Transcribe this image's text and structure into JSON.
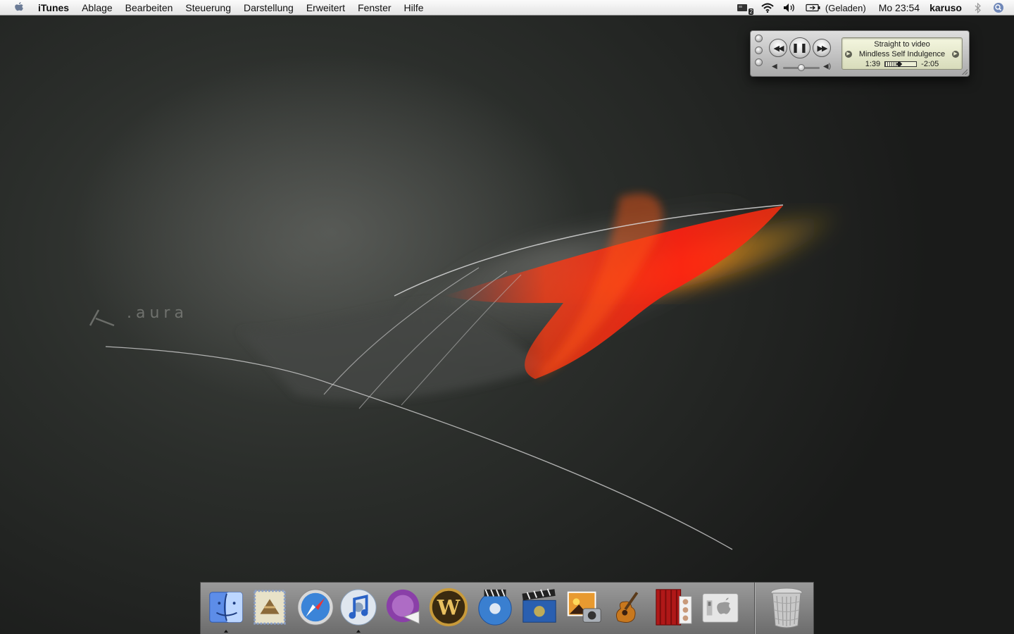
{
  "menubar": {
    "app_name": "iTunes",
    "menus": [
      "Ablage",
      "Bearbeiten",
      "Steuerung",
      "Darstellung",
      "Erweitert",
      "Fenster",
      "Hilfe"
    ],
    "extras": {
      "spaces_badge": "2",
      "battery_status": "(Geladen)",
      "clock": "Mo 23:54",
      "user": "karuso"
    }
  },
  "wallpaper": {
    "brand_text": ".aura",
    "accent_color": "#e8261a"
  },
  "miniplayer": {
    "song_title": "Straight to video",
    "artist": "Mindless Self Indulgence",
    "elapsed": "1:39",
    "remaining": "-2:05",
    "progress_fraction": 0.44,
    "volume_fraction": 0.5,
    "buttons": {
      "previous_icon": "rewind-icon",
      "play_pause_icon": "pause-icon",
      "next_icon": "fast-forward-icon"
    }
  },
  "dock": {
    "apps": [
      {
        "name": "Finder",
        "icon": "finder-icon",
        "running": true
      },
      {
        "name": "Mail",
        "icon": "mail-icon",
        "running": false
      },
      {
        "name": "Safari",
        "icon": "safari-icon",
        "running": false
      },
      {
        "name": "iTunes",
        "icon": "itunes-icon",
        "running": true
      },
      {
        "name": "iChat",
        "icon": "ichat-icon",
        "running": false
      },
      {
        "name": "World of Warcraft",
        "icon": "warcraft-icon",
        "running": false
      },
      {
        "name": "DVD Player",
        "icon": "dvd-player-icon",
        "running": false
      },
      {
        "name": "iMovie",
        "icon": "imovie-icon",
        "running": false
      },
      {
        "name": "iPhoto",
        "icon": "iphoto-icon",
        "running": false
      },
      {
        "name": "GarageBand",
        "icon": "garageband-icon",
        "running": false
      },
      {
        "name": "Photo Booth",
        "icon": "photo-booth-icon",
        "running": false
      },
      {
        "name": "System Preferences",
        "icon": "system-preferences-icon",
        "running": false
      }
    ],
    "trash": {
      "name": "Trash",
      "icon": "trash-icon"
    }
  }
}
